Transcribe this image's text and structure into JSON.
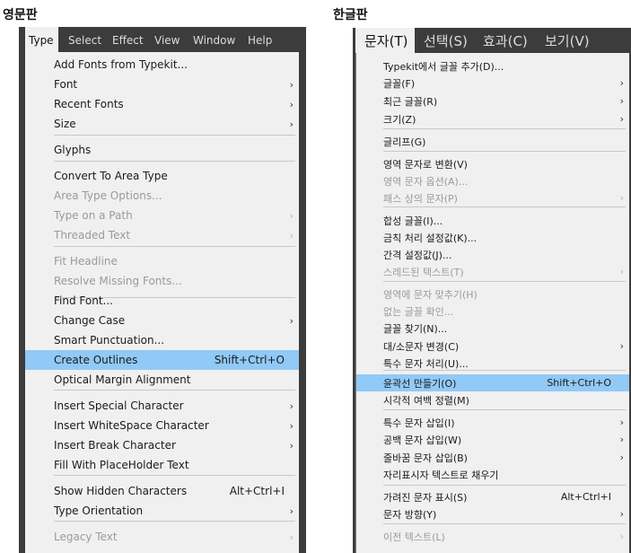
{
  "captions": {
    "english": "영문판",
    "korean": "한글판"
  },
  "english": {
    "menubar": [
      "Type",
      "Select",
      "Effect",
      "View",
      "Window",
      "Help"
    ],
    "items": [
      {
        "label": "Add Fonts from Typekit...",
        "shortcut": "",
        "submenu": false,
        "disabled": false,
        "highlighted": false
      },
      {
        "label": "Font",
        "shortcut": "",
        "submenu": true,
        "disabled": false,
        "highlighted": false
      },
      {
        "label": "Recent Fonts",
        "shortcut": "",
        "submenu": true,
        "disabled": false,
        "highlighted": false
      },
      {
        "label": "Size",
        "shortcut": "",
        "submenu": true,
        "disabled": false,
        "highlighted": false
      },
      {
        "label": "Glyphs",
        "shortcut": "",
        "submenu": false,
        "disabled": false,
        "highlighted": false
      },
      {
        "label": "Convert To Area Type",
        "shortcut": "",
        "submenu": false,
        "disabled": false,
        "highlighted": false
      },
      {
        "label": "Area Type Options...",
        "shortcut": "",
        "submenu": false,
        "disabled": true,
        "highlighted": false
      },
      {
        "label": "Type on a Path",
        "shortcut": "",
        "submenu": true,
        "disabled": true,
        "highlighted": false
      },
      {
        "label": "Threaded Text",
        "shortcut": "",
        "submenu": true,
        "disabled": true,
        "highlighted": false
      },
      {
        "label": "Fit Headline",
        "shortcut": "",
        "submenu": false,
        "disabled": true,
        "highlighted": false
      },
      {
        "label": "Resolve Missing Fonts...",
        "shortcut": "",
        "submenu": false,
        "disabled": true,
        "highlighted": false
      },
      {
        "label": "Find Font...",
        "shortcut": "",
        "submenu": false,
        "disabled": false,
        "highlighted": false
      },
      {
        "label": "Change Case",
        "shortcut": "",
        "submenu": true,
        "disabled": false,
        "highlighted": false
      },
      {
        "label": "Smart Punctuation...",
        "shortcut": "",
        "submenu": false,
        "disabled": false,
        "highlighted": false
      },
      {
        "label": "Create Outlines",
        "shortcut": "Shift+Ctrl+O",
        "submenu": false,
        "disabled": false,
        "highlighted": true
      },
      {
        "label": "Optical Margin Alignment",
        "shortcut": "",
        "submenu": false,
        "disabled": false,
        "highlighted": false
      },
      {
        "label": "Insert Special Character",
        "shortcut": "",
        "submenu": true,
        "disabled": false,
        "highlighted": false
      },
      {
        "label": "Insert WhiteSpace Character",
        "shortcut": "",
        "submenu": true,
        "disabled": false,
        "highlighted": false
      },
      {
        "label": "Insert Break Character",
        "shortcut": "",
        "submenu": true,
        "disabled": false,
        "highlighted": false
      },
      {
        "label": "Fill With PlaceHolder Text",
        "shortcut": "",
        "submenu": false,
        "disabled": false,
        "highlighted": false
      },
      {
        "label": "Show Hidden Characters",
        "shortcut": "Alt+Ctrl+I",
        "submenu": false,
        "disabled": false,
        "highlighted": false
      },
      {
        "label": "Type Orientation",
        "shortcut": "",
        "submenu": true,
        "disabled": false,
        "highlighted": false
      },
      {
        "label": "Legacy Text",
        "shortcut": "",
        "submenu": true,
        "disabled": true,
        "highlighted": false
      }
    ]
  },
  "korean": {
    "menubar": [
      "문자(T)",
      "선택(S)",
      "효과(C)",
      "보기(V)"
    ],
    "items": [
      {
        "label": "Typekit에서 글꼴 추가(D)...",
        "shortcut": "",
        "submenu": false,
        "disabled": false,
        "highlighted": false
      },
      {
        "label": "글꼴(F)",
        "shortcut": "",
        "submenu": true,
        "disabled": false,
        "highlighted": false
      },
      {
        "label": "최근 글꼴(R)",
        "shortcut": "",
        "submenu": true,
        "disabled": false,
        "highlighted": false
      },
      {
        "label": "크기(Z)",
        "shortcut": "",
        "submenu": true,
        "disabled": false,
        "highlighted": false
      },
      {
        "label": "글리프(G)",
        "shortcut": "",
        "submenu": false,
        "disabled": false,
        "highlighted": false
      },
      {
        "label": "영역 문자로 변환(V)",
        "shortcut": "",
        "submenu": false,
        "disabled": false,
        "highlighted": false
      },
      {
        "label": "영역 문자 옵션(A)...",
        "shortcut": "",
        "submenu": false,
        "disabled": true,
        "highlighted": false
      },
      {
        "label": "패스 상의 문자(P)",
        "shortcut": "",
        "submenu": true,
        "disabled": true,
        "highlighted": false
      },
      {
        "label": "합성 글꼴(I)...",
        "shortcut": "",
        "submenu": false,
        "disabled": false,
        "highlighted": false
      },
      {
        "label": "금칙 처리 설정값(K)...",
        "shortcut": "",
        "submenu": false,
        "disabled": false,
        "highlighted": false
      },
      {
        "label": "간격 설정값(J)...",
        "shortcut": "",
        "submenu": false,
        "disabled": false,
        "highlighted": false
      },
      {
        "label": "스레드된 텍스트(T)",
        "shortcut": "",
        "submenu": true,
        "disabled": true,
        "highlighted": false
      },
      {
        "label": "영역에 문자 맞추기(H)",
        "shortcut": "",
        "submenu": false,
        "disabled": true,
        "highlighted": false
      },
      {
        "label": "없는 글꼴 확인...",
        "shortcut": "",
        "submenu": false,
        "disabled": true,
        "highlighted": false
      },
      {
        "label": "글꼴 찾기(N)...",
        "shortcut": "",
        "submenu": false,
        "disabled": false,
        "highlighted": false
      },
      {
        "label": "대/소문자 변경(C)",
        "shortcut": "",
        "submenu": true,
        "disabled": false,
        "highlighted": false
      },
      {
        "label": "특수 문자 처리(U)...",
        "shortcut": "",
        "submenu": false,
        "disabled": false,
        "highlighted": false
      },
      {
        "label": "윤곽선 만들기(O)",
        "shortcut": "Shift+Ctrl+O",
        "submenu": false,
        "disabled": false,
        "highlighted": true
      },
      {
        "label": "시각적 여백 정렬(M)",
        "shortcut": "",
        "submenu": false,
        "disabled": false,
        "highlighted": false
      },
      {
        "label": "특수 문자 삽입(I)",
        "shortcut": "",
        "submenu": true,
        "disabled": false,
        "highlighted": false
      },
      {
        "label": "공백 문자 삽입(W)",
        "shortcut": "",
        "submenu": true,
        "disabled": false,
        "highlighted": false
      },
      {
        "label": "줄바꿈 문자 삽입(B)",
        "shortcut": "",
        "submenu": true,
        "disabled": false,
        "highlighted": false
      },
      {
        "label": "자리표시자 텍스트로 채우기",
        "shortcut": "",
        "submenu": false,
        "disabled": false,
        "highlighted": false
      },
      {
        "label": "가려진 문자 표시(S)",
        "shortcut": "Alt+Ctrl+I",
        "submenu": false,
        "disabled": false,
        "highlighted": false
      },
      {
        "label": "문자 방향(Y)",
        "shortcut": "",
        "submenu": true,
        "disabled": false,
        "highlighted": false
      },
      {
        "label": "이전 텍스트(L)",
        "shortcut": "",
        "submenu": true,
        "disabled": true,
        "highlighted": false
      }
    ]
  },
  "icons": {
    "submenu": "chevron-right-icon"
  },
  "colors": {
    "menu_bg": "#f0f0f0",
    "menubar_bg": "#3c3c3c",
    "highlight": "#91c9f7",
    "disabled_text": "#9a9a9a"
  }
}
